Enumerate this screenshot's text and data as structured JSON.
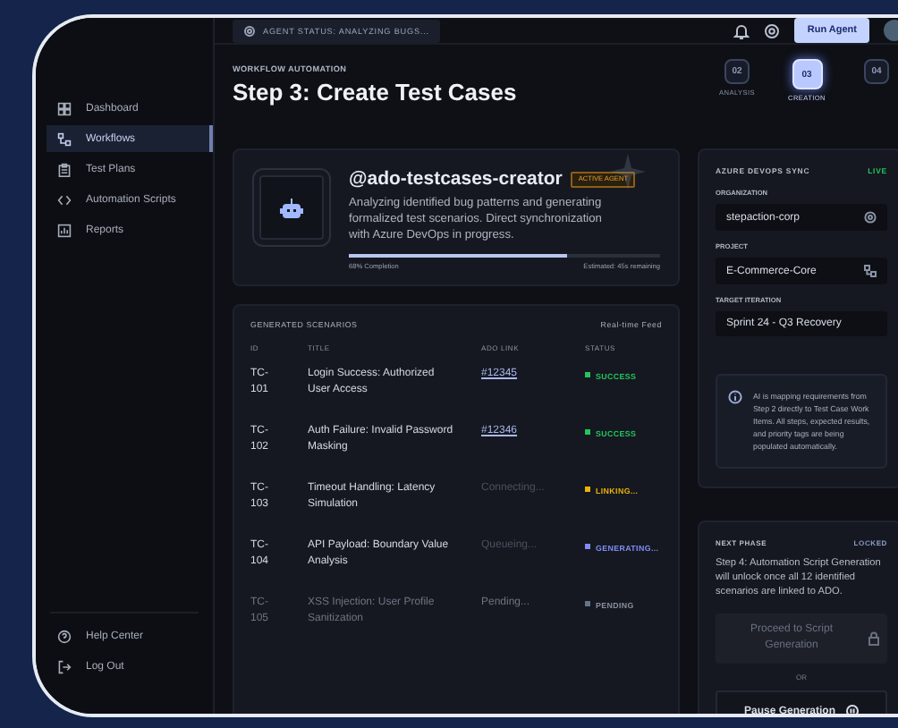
{
  "top_bar": {
    "agent_status": "AGENT STATUS: ANALYZING BUGS...",
    "run_button": "Run Agent"
  },
  "sidebar": {
    "items": [
      {
        "label": "Dashboard",
        "kind": "grid",
        "selected": false
      },
      {
        "label": "Workflows",
        "kind": "flow",
        "selected": true
      },
      {
        "label": "Test Plans",
        "kind": "clipboard",
        "selected": false
      },
      {
        "label": "Automation Scripts",
        "kind": "code",
        "selected": false
      },
      {
        "label": "Reports",
        "kind": "chart",
        "selected": false
      }
    ],
    "footer": [
      {
        "label": "Help Center",
        "kind": "help"
      },
      {
        "label": "Log Out",
        "kind": "logout"
      }
    ]
  },
  "header": {
    "eyebrow": "WORKFLOW AUTOMATION",
    "title": "Step 3: Create Test Cases"
  },
  "steps": [
    {
      "number": "02",
      "label": "ANALYSIS",
      "selected": false
    },
    {
      "number": "03",
      "label": "CREATION",
      "selected": true
    },
    {
      "number": "04",
      "selected": false
    }
  ],
  "agent": {
    "handle": "@ado-testcases-creator",
    "badge": "ACTIVE AGENT",
    "description": "Analyzing identified bug patterns and generating formalized test scenarios. Direct synchronization with Azure DevOps in progress.",
    "level": 0.7,
    "progress_label": "68% Completion",
    "estimate": "Estimated: 45s remaining"
  },
  "scenarios": {
    "title": "GENERATED SCENARIOS",
    "feed": "Real-time Feed",
    "columns": [
      "ID",
      "TITLE",
      "ADO LINK",
      "STATUS"
    ],
    "rows": [
      {
        "id": "TC-101",
        "title": "Login Success: Authorized User Access",
        "link": "#12345",
        "kind": "link",
        "status": "SUCCESS",
        "color": "#22c55e",
        "faded": false
      },
      {
        "id": "TC-102",
        "title": "Auth Failure: Invalid Password Masking",
        "link": "#12346",
        "kind": "link",
        "status": "SUCCESS",
        "color": "#22c55e",
        "faded": false
      },
      {
        "id": "TC-103",
        "title": "Timeout Handling: Latency Simulation",
        "link": "Connecting...",
        "kind": "text",
        "status": "LINKING...",
        "color": "#eab308",
        "faded": false
      },
      {
        "id": "TC-104",
        "title": "API Payload: Boundary Value Analysis",
        "link": "Queueing...",
        "kind": "text",
        "status": "GENERATING...",
        "color": "#818cf8",
        "faded": false
      },
      {
        "id": "TC-105",
        "title": "XSS Injection: User Profile Sanitization",
        "link": "Pending...",
        "kind": "text",
        "status": "PENDING",
        "color": "#64748b",
        "faded": true
      }
    ]
  },
  "sync": {
    "title": "AZURE DEVOPS SYNC",
    "live": "LIVE",
    "fields": [
      {
        "label": "ORGANIZATION",
        "value": "stepaction-corp",
        "kind": "org"
      },
      {
        "label": "PROJECT",
        "value": "E-Commerce-Core",
        "kind": "project"
      },
      {
        "label": "TARGET ITERATION",
        "value": "Sprint 24 - Q3 Recovery",
        "kind": "plain"
      }
    ],
    "note": "AI is mapping requirements from Step 2 directly to Test Case Work Items. All steps, expected results, and priority tags are being populated automatically."
  },
  "next_phase": {
    "title": "NEXT PHASE",
    "state": "LOCKED",
    "description": "Step 4: Automation Script Generation will unlock once all 12 identified scenarios are linked to ADO.",
    "proceed_button": "Proceed to Script Generation",
    "proceed_disabled": true,
    "separator": "OR",
    "pause_button": "Pause Generation"
  }
}
